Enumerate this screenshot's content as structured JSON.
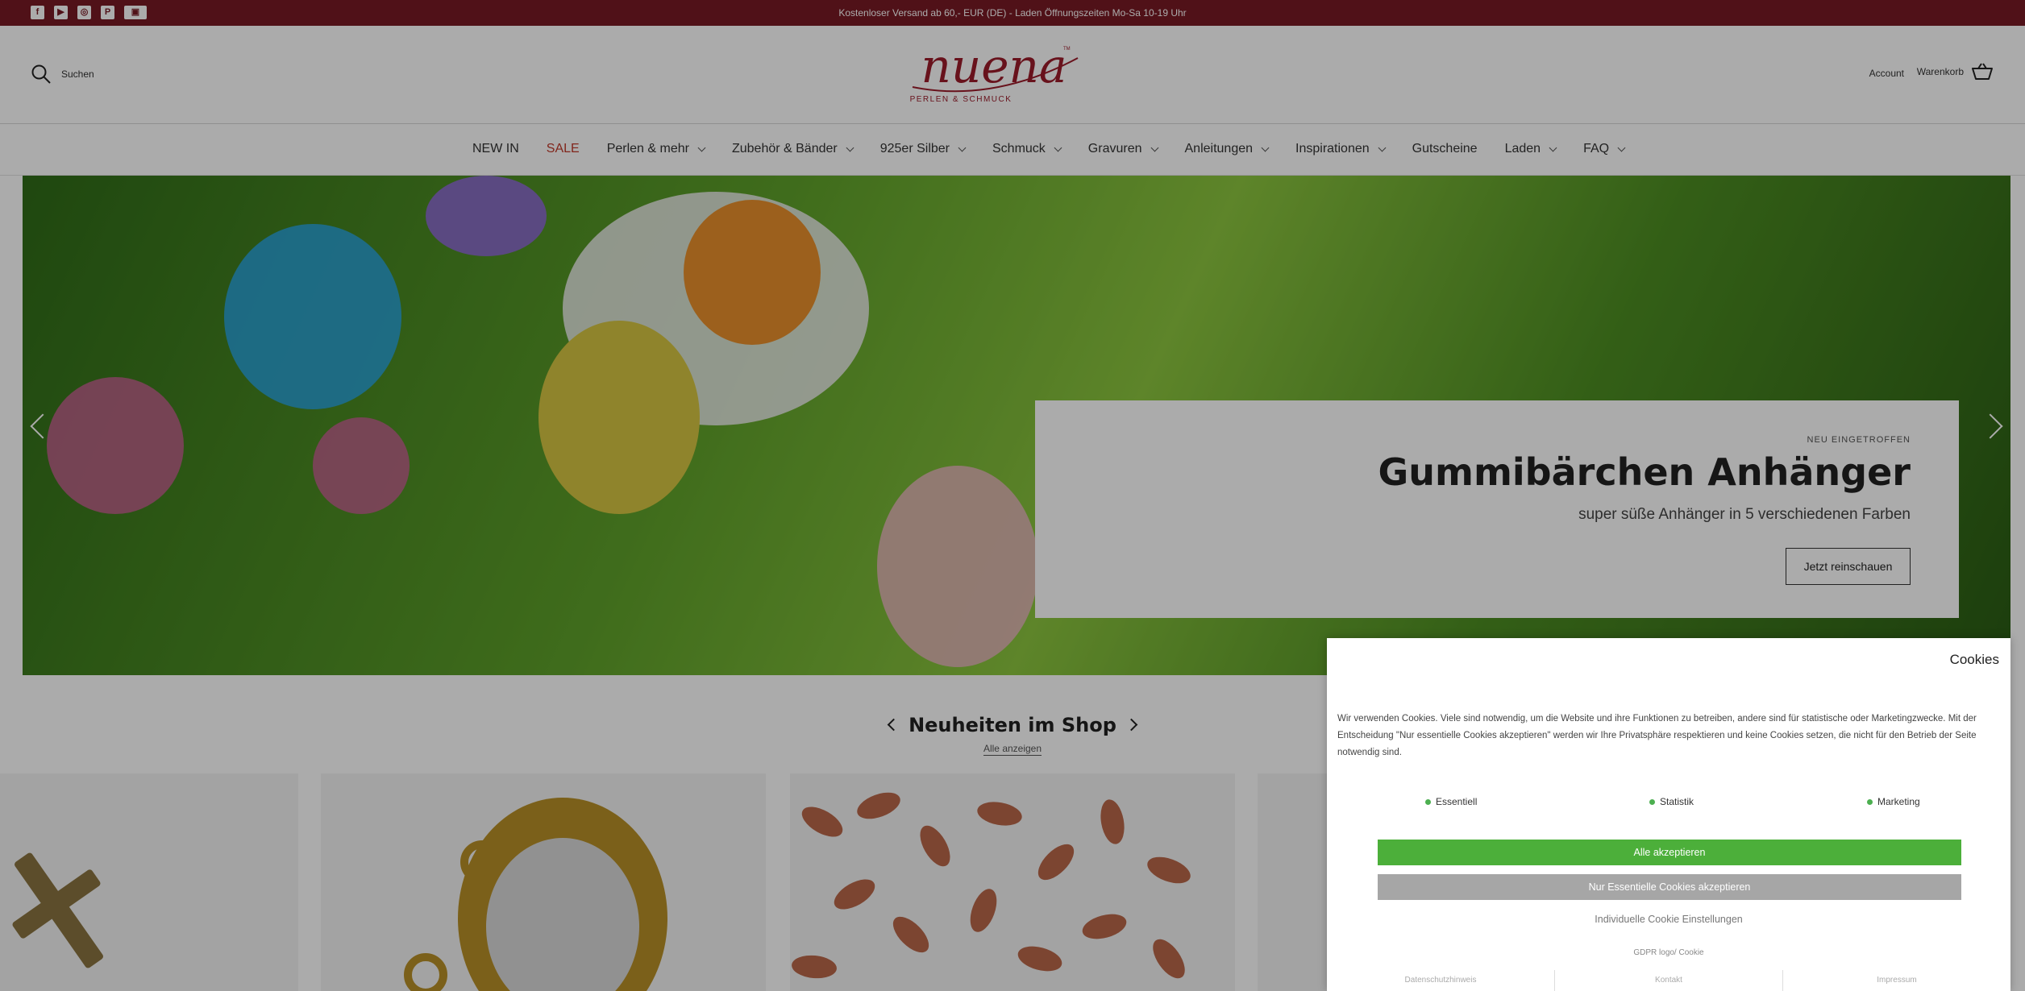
{
  "topbar": {
    "announcement": "Kostenloser Versand ab 60,- EUR (DE) - Laden Öffnungszeiten Mo-Sa 10-19 Uhr",
    "social_icons": [
      "facebook-icon",
      "youtube-icon",
      "instagram-icon",
      "pinterest-icon",
      "blog-icon"
    ]
  },
  "header": {
    "search_label": "Suchen",
    "logo_text": "nuena",
    "logo_tm": "TM",
    "logo_tagline": "PERLEN & SCHMUCK",
    "account_label": "Account",
    "cart_label": "Warenkorb"
  },
  "nav": {
    "items": [
      {
        "label": "NEW IN",
        "dropdown": false
      },
      {
        "label": "SALE",
        "dropdown": false
      },
      {
        "label": "Perlen & mehr",
        "dropdown": true
      },
      {
        "label": "Zubehör & Bänder",
        "dropdown": true
      },
      {
        "label": "925er Silber",
        "dropdown": true
      },
      {
        "label": "Schmuck",
        "dropdown": true
      },
      {
        "label": "Gravuren",
        "dropdown": true
      },
      {
        "label": "Anleitungen",
        "dropdown": true
      },
      {
        "label": "Inspirationen",
        "dropdown": true
      },
      {
        "label": "Gutscheine",
        "dropdown": false
      },
      {
        "label": "Laden",
        "dropdown": true
      },
      {
        "label": "FAQ",
        "dropdown": true
      }
    ]
  },
  "hero": {
    "subheading": "NEU EINGETROFFEN",
    "title": "Gummibärchen Anhänger",
    "description": "super süße Anhänger in 5 verschiedenen Farben",
    "button": "Jetzt reinschauen"
  },
  "news": {
    "title": "Neuheiten im Shop",
    "view_all": "Alle anzeigen"
  },
  "cookie": {
    "title": "Cookies",
    "text": "Wir verwenden Cookies. Viele sind notwendig, um die Website und ihre Funktionen zu betreiben, andere sind für statistische oder Marketingzwecke. Mit der Entscheidung \"Nur essentielle Cookies akzeptieren\" werden wir Ihre Privatsphäre respektieren und keine Cookies setzen, die nicht für den Betrieb der Seite notwendig sind.",
    "categories": [
      "Essentiell",
      "Statistik",
      "Marketing"
    ],
    "accept_all": "Alle akzeptieren",
    "accept_essential": "Nur Essentielle Cookies akzeptieren",
    "individual": "Individuelle Cookie Einstellungen",
    "gdpr": "GDPR logo/ Cookie",
    "footer_links": [
      "Datenschutzhinweis",
      "Kontakt",
      "Impressum"
    ]
  }
}
